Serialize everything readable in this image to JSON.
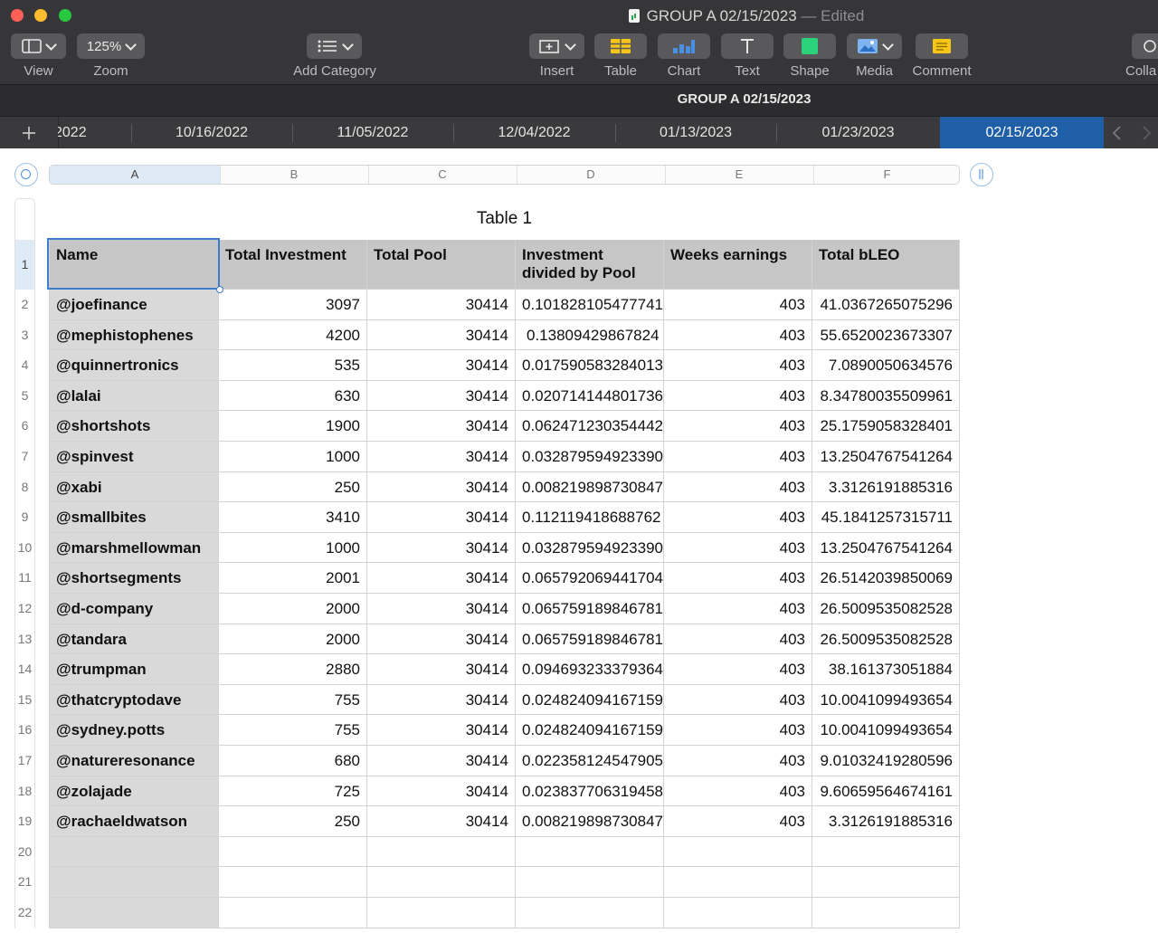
{
  "window": {
    "title": "GROUP A 02/15/2023",
    "edited": "— Edited"
  },
  "toolbar": {
    "view_label": "View",
    "zoom_value": "125%",
    "zoom_label": "Zoom",
    "add_category_label": "Add Category",
    "insert_label": "Insert",
    "table_label": "Table",
    "chart_label": "Chart",
    "text_label": "Text",
    "shape_label": "Shape",
    "media_label": "Media",
    "comment_label": "Comment",
    "collab_label": "Colla"
  },
  "sheet_title": "GROUP A 02/15/2023",
  "sheet_tabs": [
    "2022",
    "10/16/2022",
    "11/05/2022",
    "12/04/2022",
    "01/13/2023",
    "01/23/2023",
    "02/15/2023"
  ],
  "active_tab": "02/15/2023",
  "columns": [
    "A",
    "B",
    "C",
    "D",
    "E",
    "F"
  ],
  "table": {
    "title": "Table 1",
    "headers": [
      "Name",
      "Total Investment",
      "Total Pool",
      "Investment divided by Pool",
      "Weeks earnings",
      "Total bLEO"
    ],
    "rows": [
      [
        "@joefinance",
        "3097",
        "30414",
        "0.101828105477741",
        "403",
        "41.0367265075296"
      ],
      [
        "@mephistophenes",
        "4200",
        "30414",
        "0.13809429867824",
        "403",
        "55.6520023673307"
      ],
      [
        "@quinnertronics",
        "535",
        "30414",
        "0.0175905832840139",
        "403",
        "7.0890050634576"
      ],
      [
        "@lalai",
        "630",
        "30414",
        "0.020714144801736",
        "403",
        "8.34780035509961"
      ],
      [
        "@shortshots",
        "1900",
        "30414",
        "0.062471230354442",
        "403",
        "25.1759058328401"
      ],
      [
        "@spinvest",
        "1000",
        "30414",
        "0.0328795949233905",
        "403",
        "13.2504767541264"
      ],
      [
        "@xabi",
        "250",
        "30414",
        "0.00821989873084763",
        "403",
        "3.3126191885316"
      ],
      [
        "@smallbites",
        "3410",
        "30414",
        "0.112119418688762",
        "403",
        "45.1841257315711"
      ],
      [
        "@marshmellowman",
        "1000",
        "30414",
        "0.0328795949233905",
        "403",
        "13.2504767541264"
      ],
      [
        "@shortsegments",
        "2001",
        "30414",
        "0.0657920694417045",
        "403",
        "26.5142039850069"
      ],
      [
        "@d-company",
        "2000",
        "30414",
        "0.0657591898467811",
        "403",
        "26.5009535082528"
      ],
      [
        "@tandara",
        "2000",
        "30414",
        "0.0657591898467811",
        "403",
        "26.5009535082528"
      ],
      [
        "@trumpman",
        "2880",
        "30414",
        "0.0946932333793645",
        "403",
        "38.161373051884"
      ],
      [
        "@thatcryptodave",
        "755",
        "30414",
        "0.0248240941671599",
        "403",
        "10.0041099493654"
      ],
      [
        "@sydney.potts",
        "755",
        "30414",
        "0.0248240941671599",
        "403",
        "10.0041099493654"
      ],
      [
        "@natureresonance",
        "680",
        "30414",
        "0.0223581245479056",
        "403",
        "9.01032419280596"
      ],
      [
        "@zolajade",
        "725",
        "30414",
        "0.0238377063194581",
        "403",
        "9.60659564674161"
      ],
      [
        "@rachaeldwatson",
        "250",
        "30414",
        "0.00821989873084763",
        "403",
        "3.3126191885316"
      ]
    ],
    "row_numbers": [
      "1",
      "2",
      "3",
      "4",
      "5",
      "6",
      "7",
      "8",
      "9",
      "10",
      "11",
      "12",
      "13",
      "14",
      "15",
      "16",
      "17",
      "18",
      "19",
      "20",
      "21",
      "22"
    ]
  },
  "colors": {
    "toolbar_bg": "#363638",
    "active_tab": "#1f5fa8",
    "header_fill": "#c6c6c6",
    "name_fill": "#d9d9d9",
    "selection": "#3d7ccb"
  }
}
